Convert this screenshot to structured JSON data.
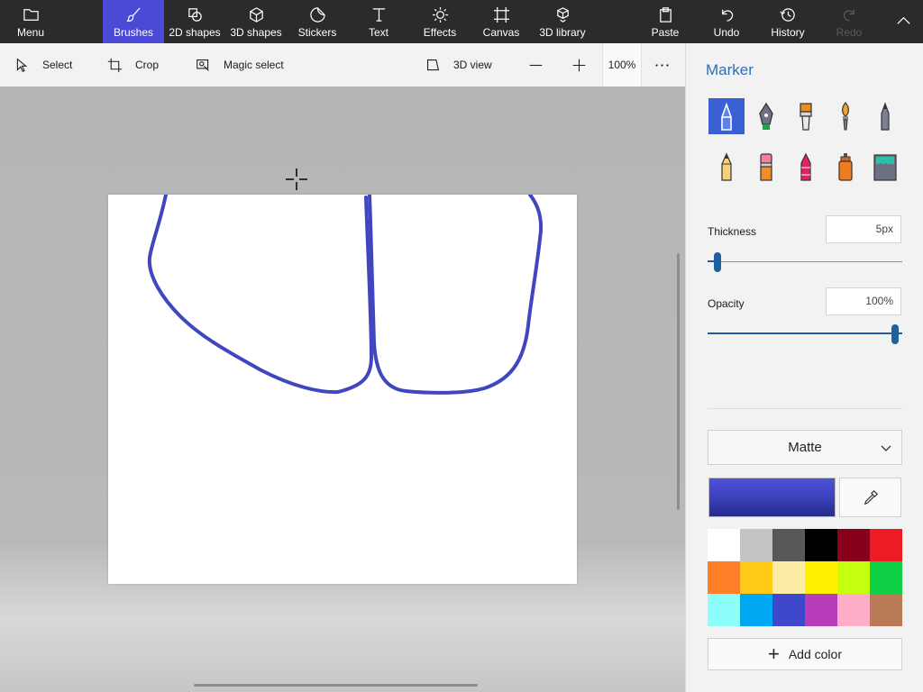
{
  "ribbon": {
    "tabs": [
      {
        "id": "menu",
        "label": "Menu",
        "icon": "folder-icon"
      },
      {
        "id": "brushes",
        "label": "Brushes",
        "icon": "brush-icon",
        "active": true
      },
      {
        "id": "2d-shapes",
        "label": "2D shapes",
        "icon": "shapes-2d-icon"
      },
      {
        "id": "3d-shapes",
        "label": "3D shapes",
        "icon": "cube-icon"
      },
      {
        "id": "stickers",
        "label": "Stickers",
        "icon": "sticker-icon"
      },
      {
        "id": "text",
        "label": "Text",
        "icon": "text-icon"
      },
      {
        "id": "effects",
        "label": "Effects",
        "icon": "sun-icon"
      },
      {
        "id": "canvas",
        "label": "Canvas",
        "icon": "canvas-icon"
      },
      {
        "id": "3d-library",
        "label": "3D library",
        "icon": "library-icon"
      }
    ],
    "actions": [
      {
        "id": "paste",
        "label": "Paste",
        "icon": "clipboard-icon"
      },
      {
        "id": "undo",
        "label": "Undo",
        "icon": "undo-icon"
      },
      {
        "id": "history",
        "label": "History",
        "icon": "history-icon"
      },
      {
        "id": "redo",
        "label": "Redo",
        "icon": "redo-icon",
        "disabled": true
      }
    ],
    "collapse_icon": "chevron-up-icon"
  },
  "toolbar": {
    "select_label": "Select",
    "crop_label": "Crop",
    "magic_select_label": "Magic select",
    "view3d_label": "3D view",
    "zoom_level": "100%",
    "more_icon": "ellipsis-icon"
  },
  "panel": {
    "title": "Marker",
    "brushes": [
      {
        "id": "marker",
        "icon": "marker-icon",
        "selected": true
      },
      {
        "id": "calligraphy-pen",
        "icon": "calligraphy-pen-icon"
      },
      {
        "id": "oil-brush",
        "icon": "oil-brush-icon"
      },
      {
        "id": "watercolor",
        "icon": "watercolor-brush-icon"
      },
      {
        "id": "pixel-pen",
        "icon": "pixel-pen-icon"
      },
      {
        "id": "pencil",
        "icon": "pencil-icon"
      },
      {
        "id": "eraser",
        "icon": "eraser-icon"
      },
      {
        "id": "crayon",
        "icon": "crayon-icon"
      },
      {
        "id": "spray-can",
        "icon": "spray-can-icon"
      },
      {
        "id": "fill",
        "icon": "fill-bucket-icon"
      }
    ],
    "thickness_label": "Thickness",
    "thickness_value": "5px",
    "thickness_fraction": 0.05,
    "opacity_label": "Opacity",
    "opacity_value": "100%",
    "opacity_fraction": 1.0,
    "finish_value": "Matte",
    "current_color": "#3f44c6",
    "eyedropper_icon": "eyedropper-icon",
    "palette": [
      "#ffffff",
      "#c3c3c3",
      "#585858",
      "#000000",
      "#88001b",
      "#ec1c24",
      "#ff7f27",
      "#ffca18",
      "#fdeca6",
      "#fff200",
      "#c4ff0e",
      "#0ed145",
      "#8cfffb",
      "#00a8f3",
      "#3f48cc",
      "#b83dba",
      "#ffaec8",
      "#b97a56"
    ],
    "add_color_label": "Add color"
  },
  "canvas": {
    "stroke_color": "#4046c0"
  }
}
